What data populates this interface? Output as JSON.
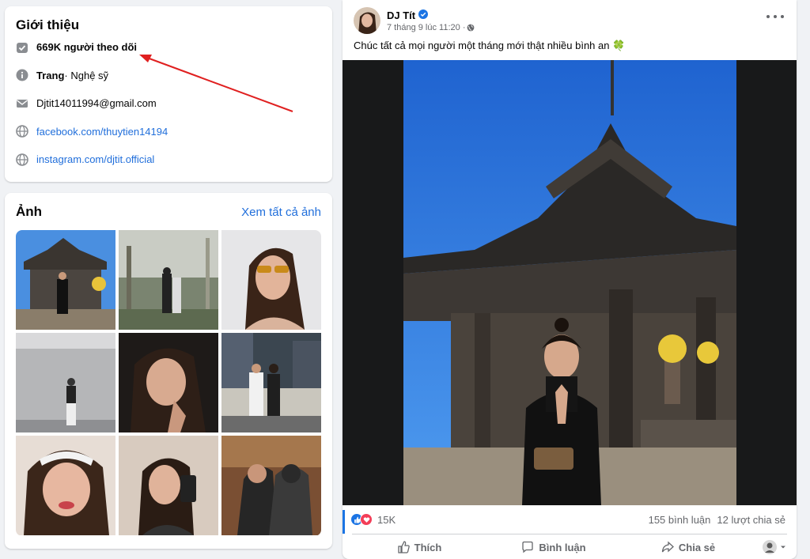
{
  "intro": {
    "title": "Giới thiệu",
    "followers": "669K người theo dõi",
    "page_label": "Trang",
    "page_category": " · Nghệ sỹ",
    "email": "Djtit14011994@gmail.com",
    "facebook": "facebook.com/thuytien14194",
    "instagram": "instagram.com/djtit.official"
  },
  "photos": {
    "title": "Ảnh",
    "see_all": "Xem tất cả ảnh"
  },
  "post": {
    "author": "DJ Tít",
    "timestamp": "7 tháng 9 lúc 11:20 · ",
    "caption": "Chúc tất cả mọi người một tháng mới thật nhiều bình an 🍀",
    "reactions_count": "15K",
    "comments": "155 bình luận",
    "shares": "12 lượt chia sẻ",
    "like_label": "Thích",
    "comment_label": "Bình luận",
    "share_label": "Chia sẻ"
  },
  "colors": {
    "accent": "#1b74e4",
    "link": "#216fdb",
    "annotation_arrow": "#e02020",
    "love": "#f33e58"
  }
}
